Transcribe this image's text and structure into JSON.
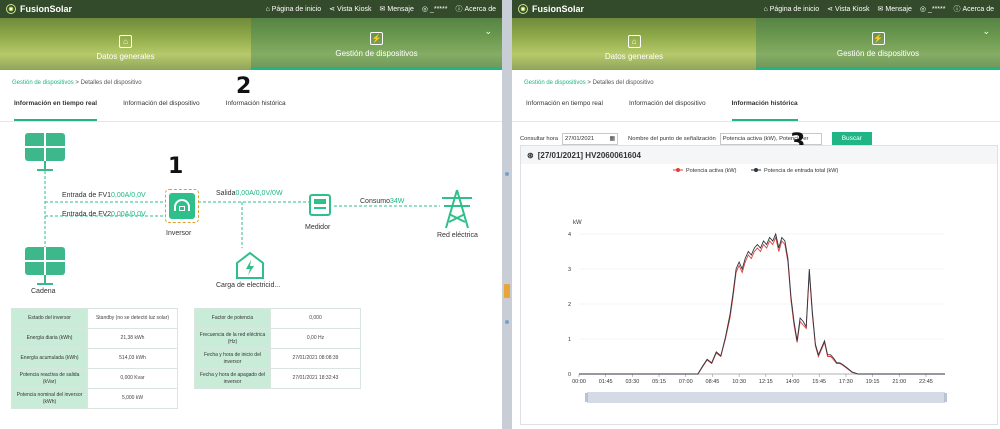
{
  "app": {
    "name": "FusionSolar",
    "links": [
      "Página de inicio",
      "Vista Kiosk",
      "Mensaje",
      "_*****",
      "Acerca de"
    ],
    "hero_tabs": [
      "Datos generales",
      "Gestión de dispositivos"
    ],
    "breadcrumb": [
      "Gestión de dispositivos",
      "Detalles del dispositivo"
    ],
    "breadcrumb_sep": ">"
  },
  "left": {
    "tabs": [
      "Información en tiempo real",
      "Información del dispositivo",
      "Información histórica"
    ],
    "annotations": [
      "1",
      "2"
    ],
    "flow": {
      "pv1_label": "Entrada de FV1",
      "pv1_value": "0,00A/0,0V",
      "pv2_label": "Entrada de FV2",
      "pv2_value": "0,00A/0,0V",
      "output_label": "Salida",
      "output_value": "0,00A/0,0V/0W",
      "consumption_label": "Consumo",
      "consumption_value": "34W",
      "inverter": "Inversor",
      "meter": "Medidor",
      "grid": "Red eléctrica",
      "string": "Cadena",
      "load": "Carga de electricid..."
    },
    "table1": [
      {
        "k": "Estado del inversor",
        "v": "Standby (no se detectó luz solar)"
      },
      {
        "k": "Energía diaria (kWh)",
        "v": "21,38 kWh"
      },
      {
        "k": "Energía acumulada (kWh)",
        "v": "514,03 kWh"
      },
      {
        "k": "Potencia reactiva de salida (kVar)",
        "v": "0,000 Kvar"
      },
      {
        "k": "Potencia nominal del inversor (kWh)",
        "v": "5,000 kW"
      }
    ],
    "table2": [
      {
        "k": "Factor de potencia",
        "v": "0,000"
      },
      {
        "k": "Frecuencia de la red eléctrica (Hz)",
        "v": "0,00 Hz"
      },
      {
        "k": "Fecha y hora de inicio del inversor",
        "v": "27/01/2021 08:08:39"
      },
      {
        "k": "Fecha y hora de apagado del inversor",
        "v": "27/01/2021 18:32:43"
      }
    ]
  },
  "right": {
    "tabs": [
      "Información en tiempo real",
      "Información del dispositivo",
      "Información histórica"
    ],
    "annotation": "3",
    "query": {
      "time_label": "Consultar hora",
      "date": "27/01/2021",
      "signal_label": "Nombre del punto de señalización",
      "signal_value": "Potencia activa (kW), Potencia er",
      "search": "Buscar"
    },
    "chart_title": "[27/01/2021] HV2060061604"
  },
  "chart_data": {
    "type": "line",
    "title": "[27/01/2021] HV2060061604",
    "ylabel": "kW",
    "ylim": [
      0,
      4
    ],
    "yticks": [
      "0",
      "1",
      "2",
      "3",
      "4"
    ],
    "xticks": [
      "00:00",
      "01:45",
      "03:30",
      "05:15",
      "07:00",
      "08:45",
      "10:30",
      "12:15",
      "14:00",
      "15:45",
      "17:30",
      "19:15",
      "21:00",
      "22:45"
    ],
    "legend_position": "top",
    "x_hours": [
      0,
      7.8,
      8.1,
      8.4,
      8.7,
      9.0,
      9.3,
      9.6,
      9.9,
      10.1,
      10.3,
      10.5,
      10.7,
      10.9,
      11.1,
      11.3,
      11.5,
      11.7,
      11.9,
      12.1,
      12.3,
      12.5,
      12.7,
      12.9,
      13.1,
      13.3,
      13.5,
      13.7,
      13.9,
      14.1,
      14.3,
      14.5,
      14.7,
      14.9,
      15.1,
      15.3,
      15.5,
      15.7,
      15.9,
      16.1,
      16.3,
      16.5,
      16.7,
      16.9,
      17.1,
      17.3,
      17.6,
      17.9,
      18.3,
      24
    ],
    "series": [
      {
        "name": "Potencia activa (kW)",
        "color": "#e0403a",
        "values": [
          0,
          0,
          0.2,
          0.4,
          0.3,
          0.6,
          0.5,
          1.0,
          1.6,
          2.2,
          2.9,
          3.1,
          2.9,
          3.2,
          3.4,
          3.3,
          3.5,
          3.6,
          3.5,
          3.7,
          3.6,
          3.8,
          3.7,
          3.9,
          3.5,
          3.8,
          3.7,
          3.2,
          2.1,
          1.4,
          0.9,
          1.5,
          1.4,
          1.3,
          2.9,
          1.7,
          0.8,
          0.5,
          0.7,
          0.9,
          0.5,
          0.5,
          0.4,
          0.3,
          0.3,
          0.25,
          0.15,
          0.05,
          0,
          0
        ]
      },
      {
        "name": "Potencia de entrada total (kW)",
        "color": "#2e3440",
        "values": [
          0,
          0,
          0.22,
          0.42,
          0.32,
          0.63,
          0.52,
          1.05,
          1.7,
          2.3,
          3.0,
          3.2,
          3.0,
          3.3,
          3.5,
          3.4,
          3.6,
          3.7,
          3.6,
          3.8,
          3.7,
          3.9,
          3.8,
          4.0,
          3.6,
          3.9,
          3.8,
          3.3,
          2.2,
          1.5,
          0.95,
          1.6,
          1.5,
          1.35,
          3.0,
          1.8,
          0.85,
          0.55,
          0.75,
          0.95,
          0.55,
          0.55,
          0.45,
          0.32,
          0.32,
          0.27,
          0.17,
          0.06,
          0,
          0
        ]
      }
    ]
  },
  "colors": {
    "accent": "#1fb584",
    "topbar": "#334b2a",
    "table_key": "#c9ecd8"
  }
}
